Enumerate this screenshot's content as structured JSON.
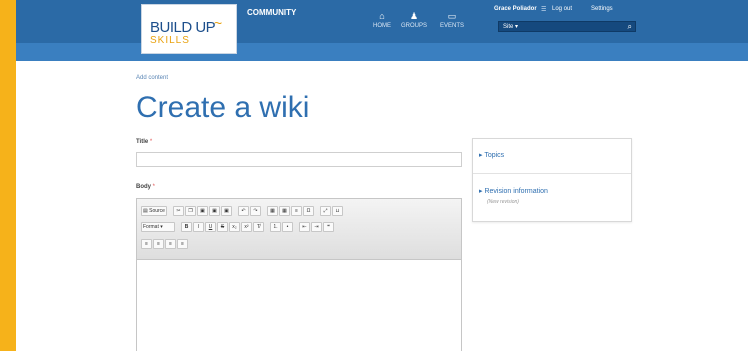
{
  "header": {
    "logo_main": "BUILD UP",
    "logo_sub": "SKILLS",
    "section": "COMMUNITY",
    "nav": [
      {
        "icon": "home-icon",
        "glyph": "⌂",
        "label": "HOME"
      },
      {
        "icon": "groups-icon",
        "glyph": "♟",
        "label": "GROUPS"
      },
      {
        "icon": "events-icon",
        "glyph": "▭",
        "label": "EVENTS"
      }
    ],
    "user": "Grace Poliador",
    "logout": "Log out",
    "settings": "Settings",
    "search_scope": "Site ▾"
  },
  "breadcrumb": "Add content",
  "page_title": "Create a wiki",
  "form": {
    "title_label": "Title",
    "body_label": "Body",
    "required_mark": "*"
  },
  "editor": {
    "source_label": "Source",
    "format_label": "Format"
  },
  "sidebar": {
    "topics": "Topics",
    "revision": "Revision information",
    "revision_sub": "(New revision)"
  },
  "colors": {
    "frame": "#f6b21a",
    "topbar": "#2b6aa6",
    "accent": "#2f6fb0"
  }
}
